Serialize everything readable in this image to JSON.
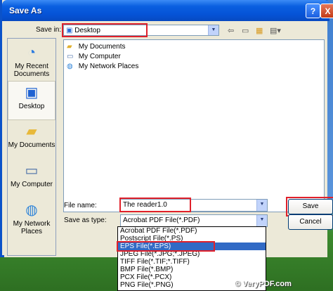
{
  "window": {
    "title": "Save As",
    "help_btn": "?",
    "close_btn": "X"
  },
  "save_in": {
    "label": "Save in:",
    "value": "Desktop"
  },
  "places": [
    {
      "label": "My Recent Documents",
      "icon": "recent-documents-icon"
    },
    {
      "label": "Desktop",
      "icon": "desktop-icon"
    },
    {
      "label": "My Documents",
      "icon": "my-documents-icon"
    },
    {
      "label": "My Computer",
      "icon": "my-computer-icon"
    },
    {
      "label": "My Network Places",
      "icon": "network-places-icon"
    }
  ],
  "files": [
    {
      "name": "My Documents",
      "icon": "folder-icon"
    },
    {
      "name": "My Computer",
      "icon": "computer-icon"
    },
    {
      "name": "My Network Places",
      "icon": "network-icon"
    }
  ],
  "file_name": {
    "label": "File name:",
    "value": "The reader1.0"
  },
  "save_as_type": {
    "label": "Save as type:",
    "value": "Acrobat PDF File(*.PDF)",
    "options": [
      "Acrobat PDF File(*.PDF)",
      "Postscript File(*.PS)",
      "EPS File(*.EPS)",
      "JPEG File(*.JPG;*.JPEG)",
      "TIFF File(*.TIF;*.TIFF)",
      "BMP File(*.BMP)",
      "PCX File(*.PCX)",
      "PNG File(*.PNG)"
    ],
    "selected_index": 2
  },
  "buttons": {
    "save": "Save",
    "cancel": "Cancel"
  },
  "watermark": "© VeryPDF.com",
  "colors": {
    "title_bar": "#0553d6",
    "highlight": "#316ac5",
    "annotation_box": "#e0202a"
  }
}
